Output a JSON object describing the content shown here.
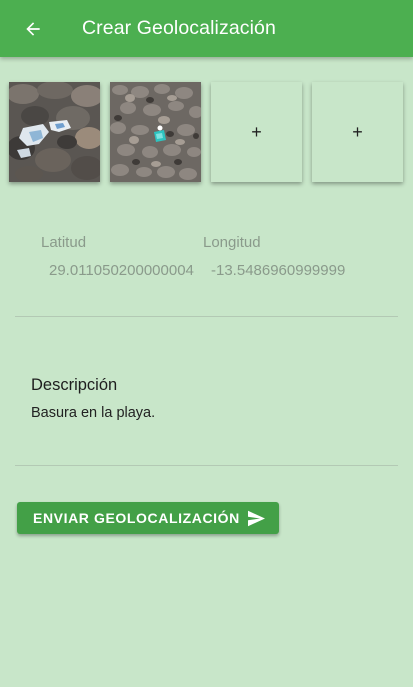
{
  "header": {
    "title": "Crear Geolocalización",
    "back_icon": "arrow-back-icon",
    "background": "#4caf50"
  },
  "photos": {
    "items": [
      {
        "type": "photo",
        "description": "beach rocks with plastic litter"
      },
      {
        "type": "photo",
        "description": "gravel with blue litter fragment"
      },
      {
        "type": "add",
        "label": "+"
      },
      {
        "type": "add",
        "label": "+"
      }
    ]
  },
  "coordinates": {
    "latitude_label": "Latitud",
    "longitude_label": "Longitud",
    "latitude_value": "29.011050200000004",
    "longitude_value": "-13.5486960999999"
  },
  "description": {
    "label": "Descripción",
    "value": "Basura en la playa."
  },
  "submit": {
    "label": "ENVIAR GEOLOCALIZACIÓN",
    "icon": "send-icon",
    "color": "#43a047"
  },
  "colors": {
    "page_background": "#c8e6c9",
    "accent": "#4caf50"
  }
}
